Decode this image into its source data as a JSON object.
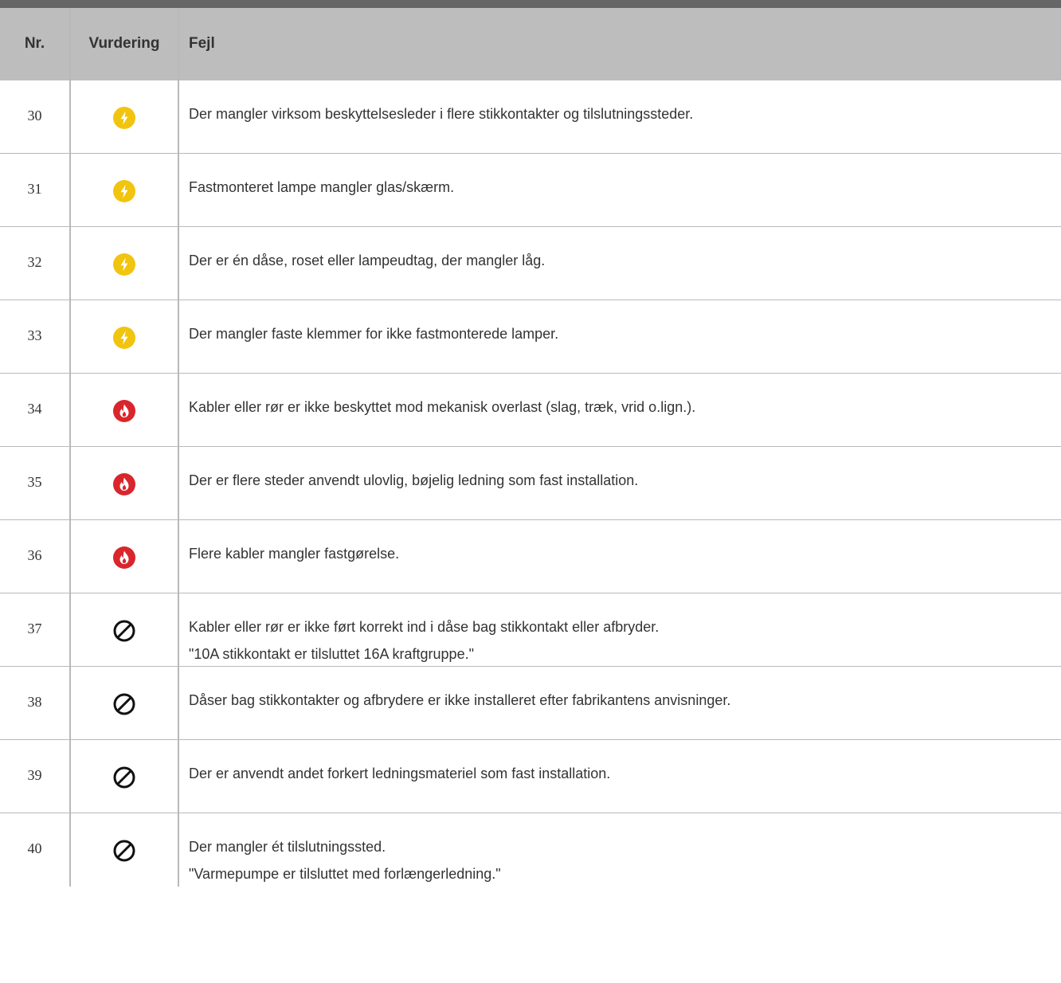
{
  "header": {
    "nr": "Nr.",
    "vurdering": "Vurdering",
    "fejl": "Fejl"
  },
  "colors": {
    "header_bg": "#bdbdbd",
    "topbar": "#666666",
    "lightning": "#f1c40f",
    "fire": "#d9262c",
    "forbidden": "#111111"
  },
  "rows": [
    {
      "nr": "30",
      "icon": "lightning-icon",
      "text": "Der mangler virksom beskyttelsesleder i flere stikkontakter og tilslutningssteder.",
      "note": ""
    },
    {
      "nr": "31",
      "icon": "lightning-icon",
      "text": "Fastmonteret lampe mangler glas/skærm.",
      "note": ""
    },
    {
      "nr": "32",
      "icon": "lightning-icon",
      "text": "Der er én dåse, roset eller lampeudtag, der mangler låg.",
      "note": ""
    },
    {
      "nr": "33",
      "icon": "lightning-icon",
      "text": "Der mangler faste klemmer for ikke fastmonterede lamper.",
      "note": ""
    },
    {
      "nr": "34",
      "icon": "fire-icon",
      "text": "Kabler eller rør er ikke beskyttet mod mekanisk overlast (slag, træk, vrid o.lign.).",
      "note": ""
    },
    {
      "nr": "35",
      "icon": "fire-icon",
      "text": "Der er flere steder anvendt ulovlig, bøjelig ledning som fast installation.",
      "note": ""
    },
    {
      "nr": "36",
      "icon": "fire-icon",
      "text": "Flere kabler mangler fastgørelse.",
      "note": ""
    },
    {
      "nr": "37",
      "icon": "forbidden-icon",
      "text": "Kabler eller rør er ikke ført korrekt ind i dåse bag stikkontakt eller afbryder.",
      "note": "\"10A stikkontakt er tilsluttet 16A kraftgruppe.\""
    },
    {
      "nr": "38",
      "icon": "forbidden-icon",
      "text": "Dåser bag stikkontakter og afbrydere er ikke installeret efter fabrikantens anvisninger.",
      "note": ""
    },
    {
      "nr": "39",
      "icon": "forbidden-icon",
      "text": "Der er anvendt andet forkert ledningsmateriel som fast installation.",
      "note": ""
    },
    {
      "nr": "40",
      "icon": "forbidden-icon",
      "text": "Der mangler ét tilslutningssted.",
      "note": "\"Varmepumpe er tilsluttet med forlængerledning.\""
    }
  ]
}
